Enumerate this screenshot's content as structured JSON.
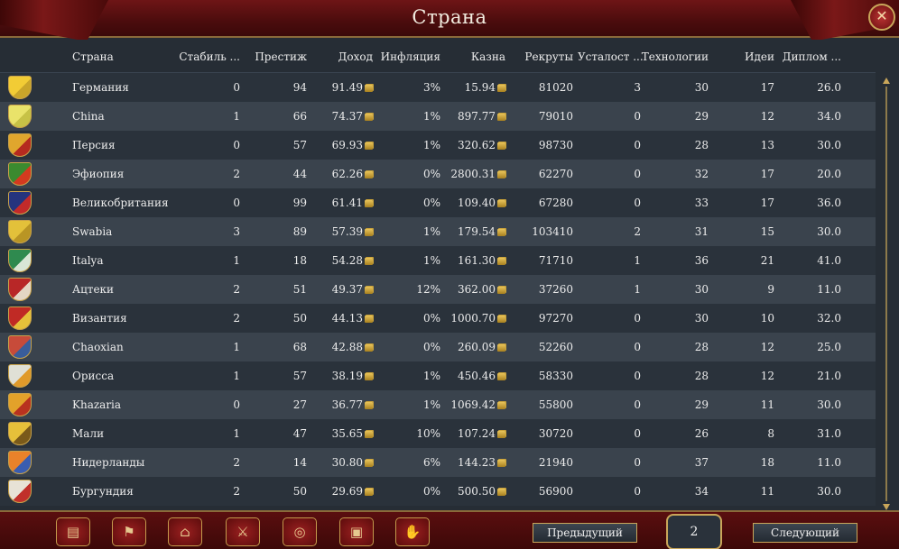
{
  "window": {
    "title": "Страна"
  },
  "columns": [
    "Страна",
    "Стабиль ...",
    "Престиж",
    "Доход",
    "Инфляция",
    "Казна",
    "Рекруты",
    "Усталост ...",
    "Технологии",
    "Идеи",
    "Диплом ..."
  ],
  "rows": [
    {
      "country": "Германия",
      "stability": "0",
      "prestige": "94",
      "income": "91.49",
      "inflation": "3%",
      "treasury": "15.94",
      "manpower": "81020",
      "war_exhaustion": "3",
      "tech": "30",
      "ideas": "17",
      "diplomacy": "26.0",
      "flag": [
        "#f2cc35",
        "#c9a52a"
      ]
    },
    {
      "country": "China",
      "stability": "1",
      "prestige": "66",
      "income": "74.37",
      "inflation": "1%",
      "treasury": "897.77",
      "manpower": "79010",
      "war_exhaustion": "0",
      "tech": "29",
      "ideas": "12",
      "diplomacy": "34.0",
      "flag": [
        "#e9e36a",
        "#c7c246"
      ]
    },
    {
      "country": "Персия",
      "stability": "0",
      "prestige": "57",
      "income": "69.93",
      "inflation": "1%",
      "treasury": "320.62",
      "manpower": "98730",
      "war_exhaustion": "0",
      "tech": "28",
      "ideas": "13",
      "diplomacy": "30.0",
      "flag": [
        "#e0a62d",
        "#b52a1f"
      ]
    },
    {
      "country": "Эфиопия",
      "stability": "2",
      "prestige": "44",
      "income": "62.26",
      "inflation": "0%",
      "treasury": "2800.31",
      "manpower": "62270",
      "war_exhaustion": "0",
      "tech": "32",
      "ideas": "17",
      "diplomacy": "20.0",
      "flag": [
        "#3b8a2f",
        "#d33a1f"
      ]
    },
    {
      "country": "Великобритания",
      "stability": "0",
      "prestige": "99",
      "income": "61.41",
      "inflation": "0%",
      "treasury": "109.40",
      "manpower": "67280",
      "war_exhaustion": "0",
      "tech": "33",
      "ideas": "17",
      "diplomacy": "36.0",
      "flag": [
        "#25347e",
        "#c22a2a"
      ]
    },
    {
      "country": "Swabia",
      "stability": "3",
      "prestige": "89",
      "income": "57.39",
      "inflation": "1%",
      "treasury": "179.54",
      "manpower": "103410",
      "war_exhaustion": "2",
      "tech": "31",
      "ideas": "15",
      "diplomacy": "30.0",
      "flag": [
        "#e3c13a",
        "#b99524"
      ]
    },
    {
      "country": "Italya",
      "stability": "1",
      "prestige": "18",
      "income": "54.28",
      "inflation": "1%",
      "treasury": "161.30",
      "manpower": "71710",
      "war_exhaustion": "1",
      "tech": "36",
      "ideas": "21",
      "diplomacy": "41.0",
      "flag": [
        "#2f8a4f",
        "#d9e6d6"
      ]
    },
    {
      "country": "Ацтеки",
      "stability": "2",
      "prestige": "51",
      "income": "49.37",
      "inflation": "12%",
      "treasury": "362.00",
      "manpower": "37260",
      "war_exhaustion": "1",
      "tech": "30",
      "ideas": "9",
      "diplomacy": "11.0",
      "flag": [
        "#b82727",
        "#e4d6c4"
      ]
    },
    {
      "country": "Византия",
      "stability": "2",
      "prestige": "50",
      "income": "44.13",
      "inflation": "0%",
      "treasury": "1000.70",
      "manpower": "97270",
      "war_exhaustion": "0",
      "tech": "30",
      "ideas": "10",
      "diplomacy": "32.0",
      "flag": [
        "#c02a25",
        "#e6c13a"
      ]
    },
    {
      "country": "Chaoxian",
      "stability": "1",
      "prestige": "68",
      "income": "42.88",
      "inflation": "0%",
      "treasury": "260.09",
      "manpower": "52260",
      "war_exhaustion": "0",
      "tech": "28",
      "ideas": "12",
      "diplomacy": "25.0",
      "flag": [
        "#c74b3a",
        "#3a5d9a"
      ]
    },
    {
      "country": "Орисса",
      "stability": "1",
      "prestige": "57",
      "income": "38.19",
      "inflation": "1%",
      "treasury": "450.46",
      "manpower": "58330",
      "war_exhaustion": "0",
      "tech": "28",
      "ideas": "12",
      "diplomacy": "21.0",
      "flag": [
        "#e0e0d6",
        "#e09a2a"
      ]
    },
    {
      "country": "Khazaria",
      "stability": "0",
      "prestige": "27",
      "income": "36.77",
      "inflation": "1%",
      "treasury": "1069.42",
      "manpower": "55800",
      "war_exhaustion": "0",
      "tech": "29",
      "ideas": "11",
      "diplomacy": "30.0",
      "flag": [
        "#e3a22a",
        "#b8321f"
      ]
    },
    {
      "country": "Мали",
      "stability": "1",
      "prestige": "47",
      "income": "35.65",
      "inflation": "10%",
      "treasury": "107.24",
      "manpower": "30720",
      "war_exhaustion": "0",
      "tech": "26",
      "ideas": "8",
      "diplomacy": "31.0",
      "flag": [
        "#e6c03a",
        "#7a5a1a"
      ]
    },
    {
      "country": "Нидерланды",
      "stability": "2",
      "prestige": "14",
      "income": "30.80",
      "inflation": "6%",
      "treasury": "144.23",
      "manpower": "21940",
      "war_exhaustion": "0",
      "tech": "37",
      "ideas": "18",
      "diplomacy": "11.0",
      "flag": [
        "#e9822a",
        "#3a5db0"
      ]
    },
    {
      "country": "Бургундия",
      "stability": "2",
      "prestige": "50",
      "income": "29.69",
      "inflation": "0%",
      "treasury": "500.50",
      "manpower": "56900",
      "war_exhaustion": "0",
      "tech": "34",
      "ideas": "11",
      "diplomacy": "30.0",
      "flag": [
        "#e7e2d6",
        "#c0302a"
      ]
    }
  ],
  "bottom_bar": {
    "toolbar_icons": [
      "ledger-icon",
      "flag-icon",
      "buildings-icon",
      "swords-icon",
      "coins-icon",
      "crate-icon",
      "handshake-icon"
    ],
    "prev_label": "Предыдущий",
    "next_label": "Следующий",
    "page": "2"
  }
}
